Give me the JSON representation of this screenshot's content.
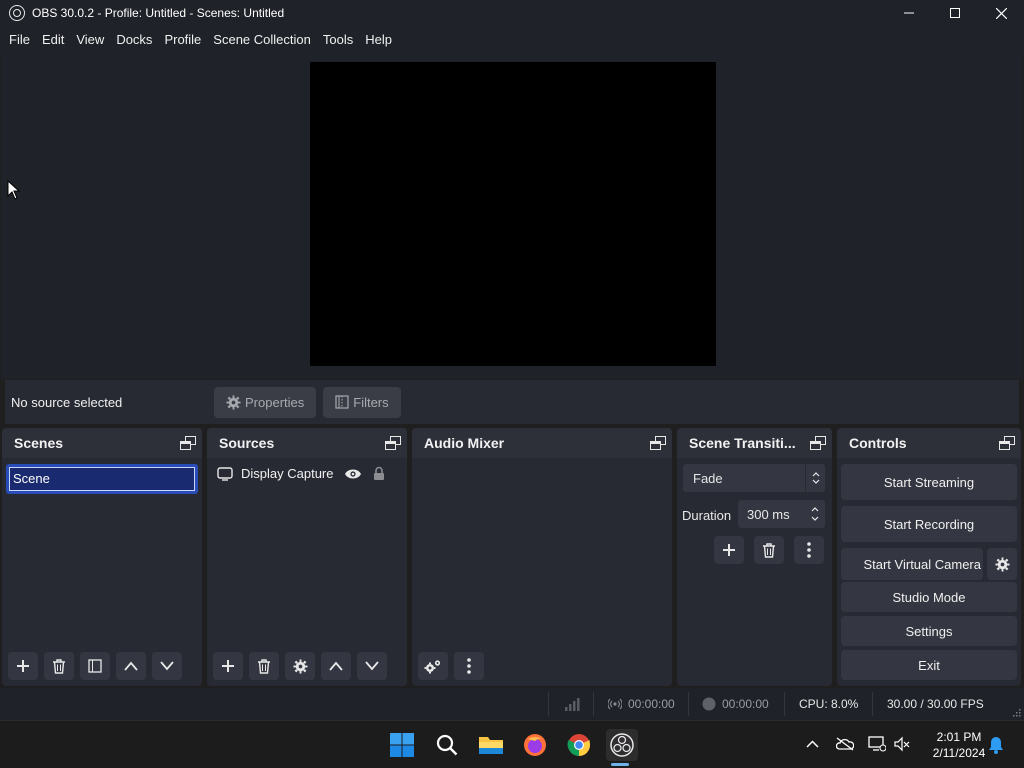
{
  "window": {
    "title": "OBS 30.0.2 - Profile: Untitled - Scenes: Untitled"
  },
  "menu": [
    "File",
    "Edit",
    "View",
    "Docks",
    "Profile",
    "Scene Collection",
    "Tools",
    "Help"
  ],
  "context_bar": {
    "status": "No source selected",
    "properties_label": "Properties",
    "filters_label": "Filters"
  },
  "docks": {
    "scenes": {
      "title": "Scenes",
      "items": [
        "Scene"
      ]
    },
    "sources": {
      "title": "Sources",
      "items": [
        {
          "label": "Display Capture",
          "visible": true,
          "locked": false
        }
      ]
    },
    "audio_mixer": {
      "title": "Audio Mixer"
    },
    "transitions": {
      "title": "Scene Transiti...",
      "selected": "Fade",
      "duration_label": "Duration",
      "duration_value": "300 ms"
    },
    "controls": {
      "title": "Controls",
      "start_streaming": "Start Streaming",
      "start_recording": "Start Recording",
      "start_virtual_camera": "Start Virtual Camera",
      "studio_mode": "Studio Mode",
      "settings": "Settings",
      "exit": "Exit"
    }
  },
  "status": {
    "streaming_time": "00:00:00",
    "recording_time": "00:00:00",
    "cpu": "CPU: 8.0%",
    "fps": "30.00 / 30.00 FPS"
  },
  "taskbar": {
    "time": "2:01 PM",
    "date": "2/11/2024",
    "apps": [
      "windows-start-icon",
      "search-icon",
      "file-explorer-icon",
      "firefox-icon",
      "chrome-icon",
      "obs-icon"
    ]
  },
  "colors": {
    "dock_bg": "#272a33",
    "accent_selected": "#284cb8",
    "button_bg": "#343741"
  }
}
